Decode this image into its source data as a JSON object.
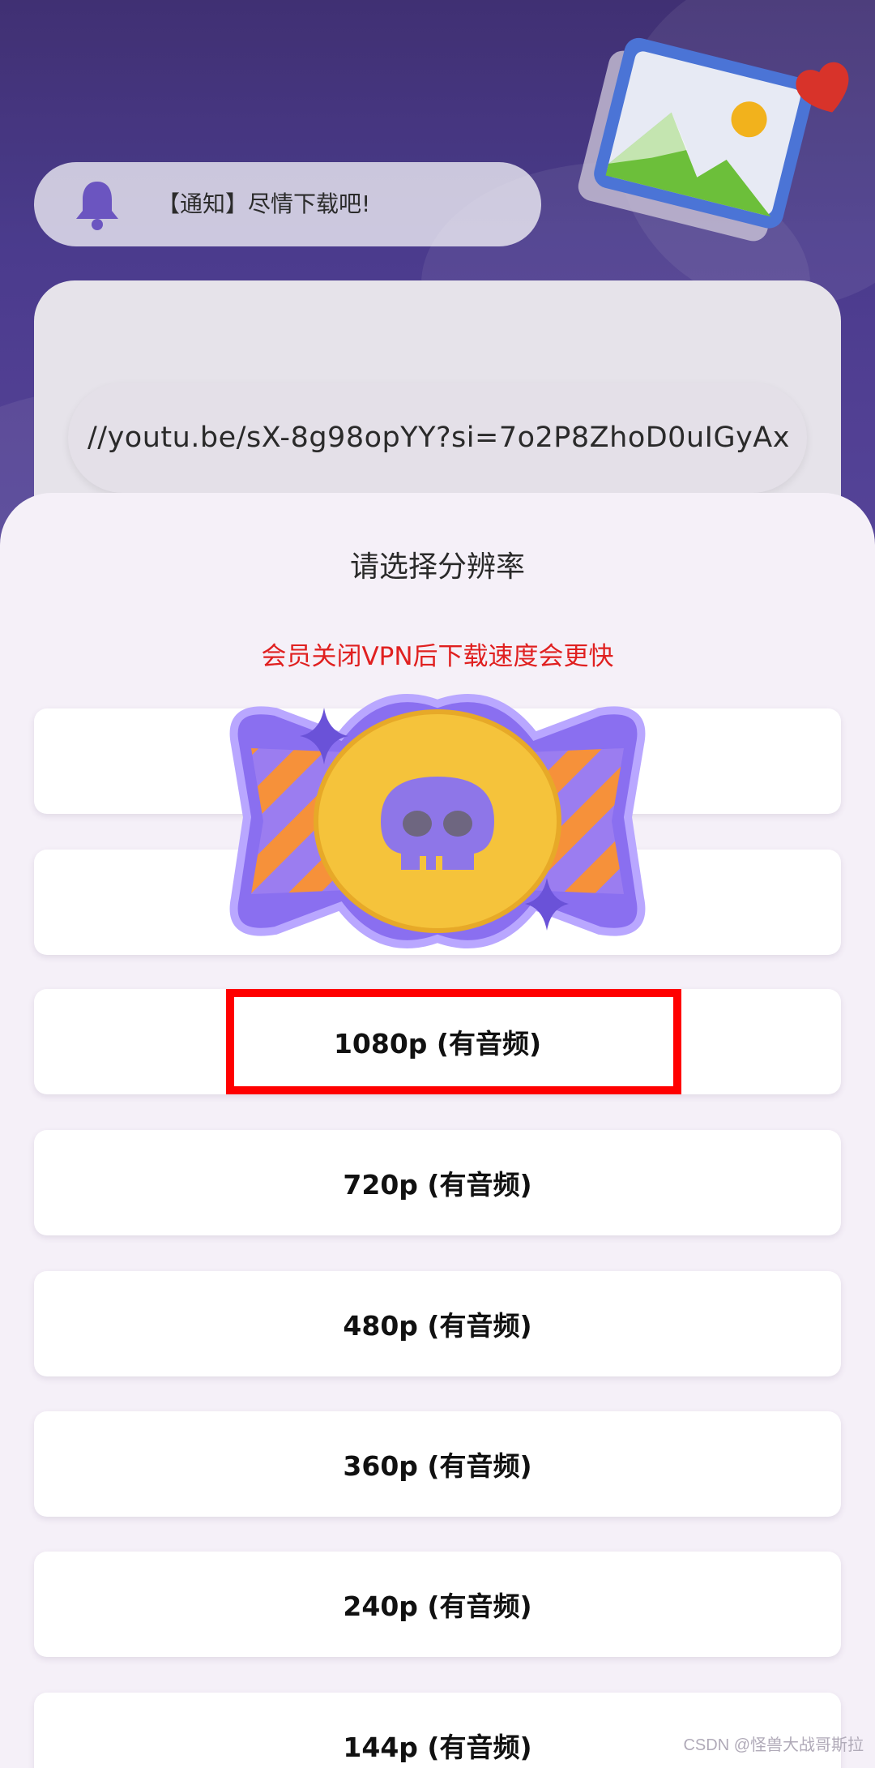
{
  "notice": {
    "text": "【通知】尽情下载吧!"
  },
  "url_input": {
    "value": "//youtu.be/sX-8g98opYY?si=7o2P8ZhoD0uIGyAx"
  },
  "sheet": {
    "title": "请选择分辨率",
    "subtitle": "会员关闭VPN后下载速度会更快",
    "options": [
      {
        "label": ""
      },
      {
        "label": ""
      },
      {
        "label": "1080p (有音频)",
        "highlighted": true
      },
      {
        "label": "720p (有音频)"
      },
      {
        "label": "480p (有音频)"
      },
      {
        "label": "360p (有音频)"
      },
      {
        "label": "240p (有音频)"
      },
      {
        "label": "144p (有音频)"
      }
    ]
  },
  "watermark": "CSDN @怪兽大战哥斯拉",
  "icons": [
    "bell-icon",
    "gallery-heart-icon",
    "skull-candy-sticker"
  ],
  "colors": {
    "accent_red": "#e02020",
    "highlight_border": "#ff0000",
    "header_purple": "#52419a"
  }
}
